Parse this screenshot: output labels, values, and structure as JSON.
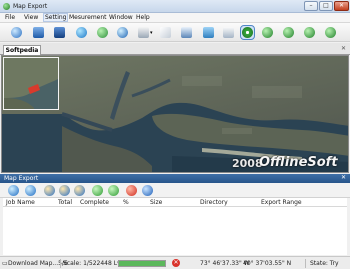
{
  "window": {
    "title": "Map Export",
    "min_label": "–",
    "max_label": "□",
    "close_label": "✕"
  },
  "menu": [
    "File",
    "View",
    "Setting",
    "Mesurement",
    "Window",
    "Help"
  ],
  "toolbar_icons": [
    "open-icon",
    "save-icon",
    "save-as-icon",
    "export-icon",
    "refresh-icon",
    "globe-icon",
    "layers-icon",
    "draw-icon",
    "image-icon",
    "print-icon",
    "target-icon",
    "zoom-in-icon",
    "zoom-out-icon",
    "zoom-fit-icon",
    "zoom-window-icon"
  ],
  "doc_tab": {
    "label": "Softpedia",
    "close": "✕"
  },
  "map": {
    "watermark_year": "2008",
    "watermark_name": "OfflineSoft"
  },
  "export_panel": {
    "title": "Map Export",
    "close": "✕",
    "tool_icons": [
      "add-task-icon",
      "edit-task-icon",
      "import-icon",
      "export-list-icon",
      "delete-icon",
      "up-icon",
      "down-icon",
      "stop-icon",
      "help-icon"
    ],
    "columns": [
      "Job Name",
      "Total",
      "Complete",
      "%",
      "Size",
      "Directory",
      "Export Range"
    ]
  },
  "status": {
    "download": "Download Map...5/6",
    "scale": "Scale: 1/522448 Lv:09",
    "progress_fraction": 1.0,
    "longitude": "73°  46'37.33\" W",
    "latitude": "40°  37'03.55\" N",
    "state": "State: Try"
  },
  "colors": {
    "title_gradient_top": "#dfe9f5",
    "panel_header": "#27548a",
    "accent_green": "#38a83a",
    "accent_blue": "#2a6fc1"
  }
}
